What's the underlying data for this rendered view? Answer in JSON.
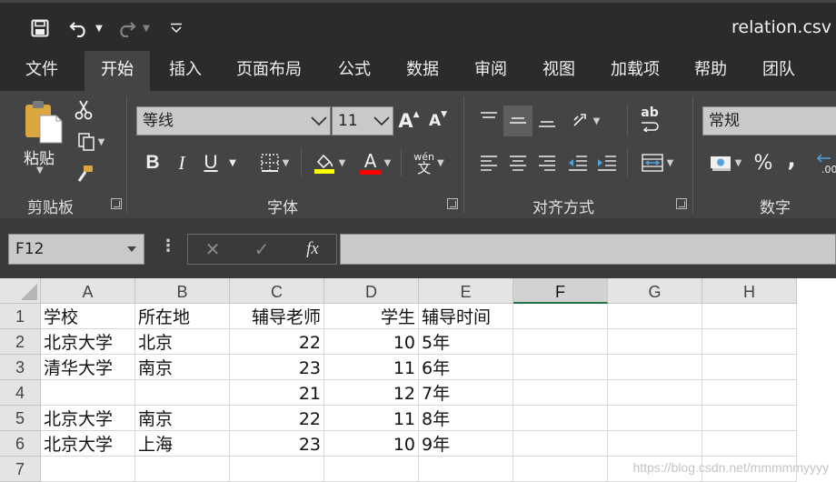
{
  "window": {
    "title": "relation.csv -"
  },
  "tabs": [
    "文件",
    "开始",
    "插入",
    "页面布局",
    "公式",
    "数据",
    "审阅",
    "视图",
    "加载项",
    "帮助",
    "团队"
  ],
  "active_tab": "开始",
  "ribbon": {
    "clipboard": {
      "label": "剪贴板",
      "paste_label": "粘贴"
    },
    "font": {
      "label": "字体",
      "font_name": "等线",
      "font_size": "11",
      "bold": "B",
      "italic": "I",
      "underline": "U",
      "grow": "A",
      "shrink": "A",
      "font_color_glyph": "A",
      "phonetic_top": "wén",
      "phonetic_bottom": "文"
    },
    "alignment": {
      "label": "对齐方式",
      "wrap_glyph": "ab"
    },
    "number": {
      "label": "数字",
      "format": "常规",
      "percent": "%",
      "comma": ","
    }
  },
  "formula_bar": {
    "name_box": "F12",
    "cancel": "✕",
    "enter": "✓",
    "fx": "fx",
    "more": "⋮",
    "value": ""
  },
  "grid": {
    "columns": [
      "A",
      "B",
      "C",
      "D",
      "E",
      "F",
      "G",
      "H"
    ],
    "selected_column": "F",
    "rows": [
      {
        "num": "1",
        "cells": [
          "学校",
          "所在地",
          "辅导老师",
          "学生",
          "辅导时间"
        ]
      },
      {
        "num": "2",
        "cells": [
          "北京大学",
          "北京",
          "22",
          "10",
          "5年"
        ]
      },
      {
        "num": "3",
        "cells": [
          "清华大学",
          "南京",
          "23",
          "11",
          "6年"
        ]
      },
      {
        "num": "4",
        "cells": [
          "",
          "",
          "21",
          "12",
          "7年"
        ]
      },
      {
        "num": "5",
        "cells": [
          "北京大学",
          "南京",
          "22",
          "11",
          "8年"
        ]
      },
      {
        "num": "6",
        "cells": [
          "北京大学",
          "上海",
          "23",
          "10",
          "9年"
        ]
      },
      {
        "num": "7",
        "cells": [
          "",
          "",
          "",
          "",
          ""
        ]
      }
    ]
  },
  "watermark": "https://blog.csdn.net/mmmmmyyyy"
}
